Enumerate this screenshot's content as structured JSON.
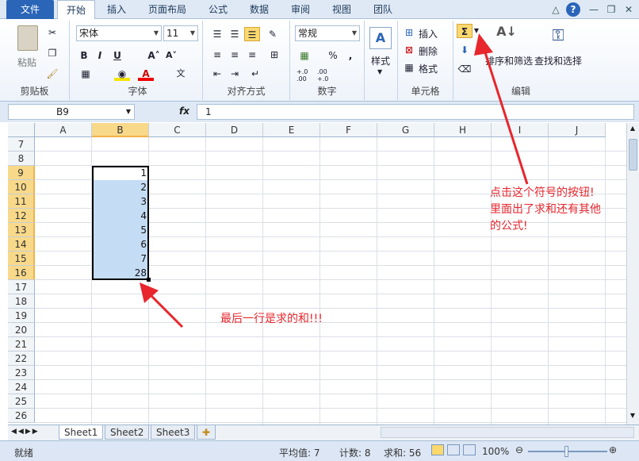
{
  "ribbon_tabs": [
    "文件",
    "开始",
    "插入",
    "页面布局",
    "公式",
    "数据",
    "审阅",
    "视图",
    "团队"
  ],
  "clipboard": {
    "paste_label": "粘贴",
    "group_label": "剪贴板"
  },
  "font": {
    "font_name": "宋体",
    "font_size": "11",
    "group_label": "字体",
    "bold": "B",
    "italic": "I",
    "underline": "U",
    "grow": "A˄",
    "shrink": "A˅"
  },
  "alignment": {
    "group_label": "对齐方式"
  },
  "number": {
    "format": "常规",
    "group_label": "数字",
    "percent": "%",
    "comma": ",",
    "inc_decimal": "+.0 .00",
    "dec_decimal": ".00 +.0"
  },
  "styles": {
    "label": "样式"
  },
  "cells": {
    "insert": "插入",
    "delete": "删除",
    "format": "格式",
    "group_label": "单元格"
  },
  "editing": {
    "sort_filter": "排序和筛选",
    "find_select": "查找和选择",
    "group_label": "编辑",
    "sum_symbol": "Σ"
  },
  "formula_bar": {
    "name_box": "B9",
    "fx": "fx",
    "value": "1"
  },
  "columns": [
    "A",
    "B",
    "C",
    "D",
    "E",
    "F",
    "G",
    "H",
    "I",
    "J"
  ],
  "rows": [
    "7",
    "8",
    "9",
    "10",
    "11",
    "12",
    "13",
    "14",
    "15",
    "16",
    "17",
    "18",
    "19",
    "20",
    "21",
    "22",
    "23",
    "24",
    "25",
    "26"
  ],
  "cells_b": [
    {
      "row": "9",
      "value": "1"
    },
    {
      "row": "10",
      "value": "2"
    },
    {
      "row": "11",
      "value": "3"
    },
    {
      "row": "12",
      "value": "4"
    },
    {
      "row": "13",
      "value": "5"
    },
    {
      "row": "14",
      "value": "6"
    },
    {
      "row": "15",
      "value": "7"
    },
    {
      "row": "16",
      "value": "28"
    }
  ],
  "sheet_tabs": [
    "Sheet1",
    "Sheet2",
    "Sheet3"
  ],
  "status": {
    "ready": "就绪",
    "average": "平均值: 7",
    "count": "计数: 8",
    "sum": "求和: 56",
    "zoom": "100%"
  },
  "annotations": {
    "sum_button_note": [
      "点击这个符号的按钮!",
      "里面出了求和还有其他",
      "的公式!"
    ],
    "last_row_note": "最后一行是求的和!!!"
  },
  "colors": {
    "selection": "#c5dcf5",
    "accent": "#2a65b8",
    "annotation": "#e8262d"
  }
}
